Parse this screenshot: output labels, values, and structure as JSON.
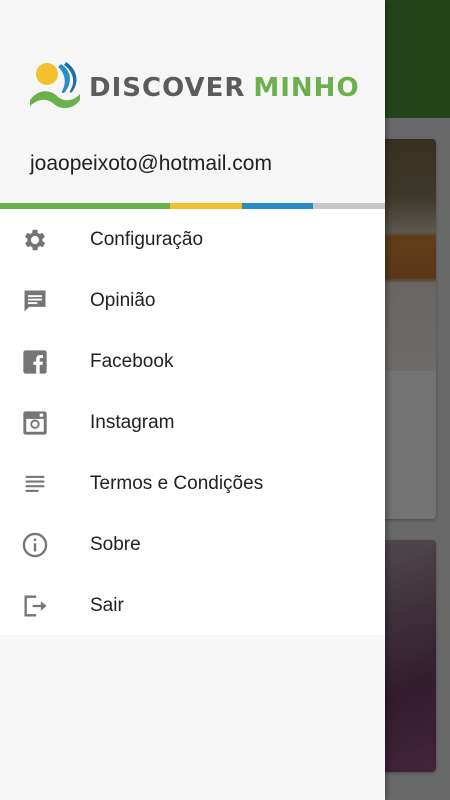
{
  "app": {
    "brand_part1": "DISCOVER",
    "brand_part2": "MINHO"
  },
  "drawer": {
    "email": "joaopeixoto@hotmail.com",
    "accent_colors": [
      "#6ab04c",
      "#f2c12e",
      "#2b8dc7",
      "#c7c7c7"
    ],
    "menu": [
      {
        "label": "Configuração",
        "icon": "gear-icon"
      },
      {
        "label": "Opinião",
        "icon": "chat-icon"
      },
      {
        "label": "Facebook",
        "icon": "facebook-icon"
      },
      {
        "label": "Instagram",
        "icon": "instagram-icon"
      },
      {
        "label": "Termos e Condições",
        "icon": "text-lines-icon"
      },
      {
        "label": "Sobre",
        "icon": "info-icon"
      },
      {
        "label": "Sair",
        "icon": "exit-icon"
      }
    ]
  }
}
